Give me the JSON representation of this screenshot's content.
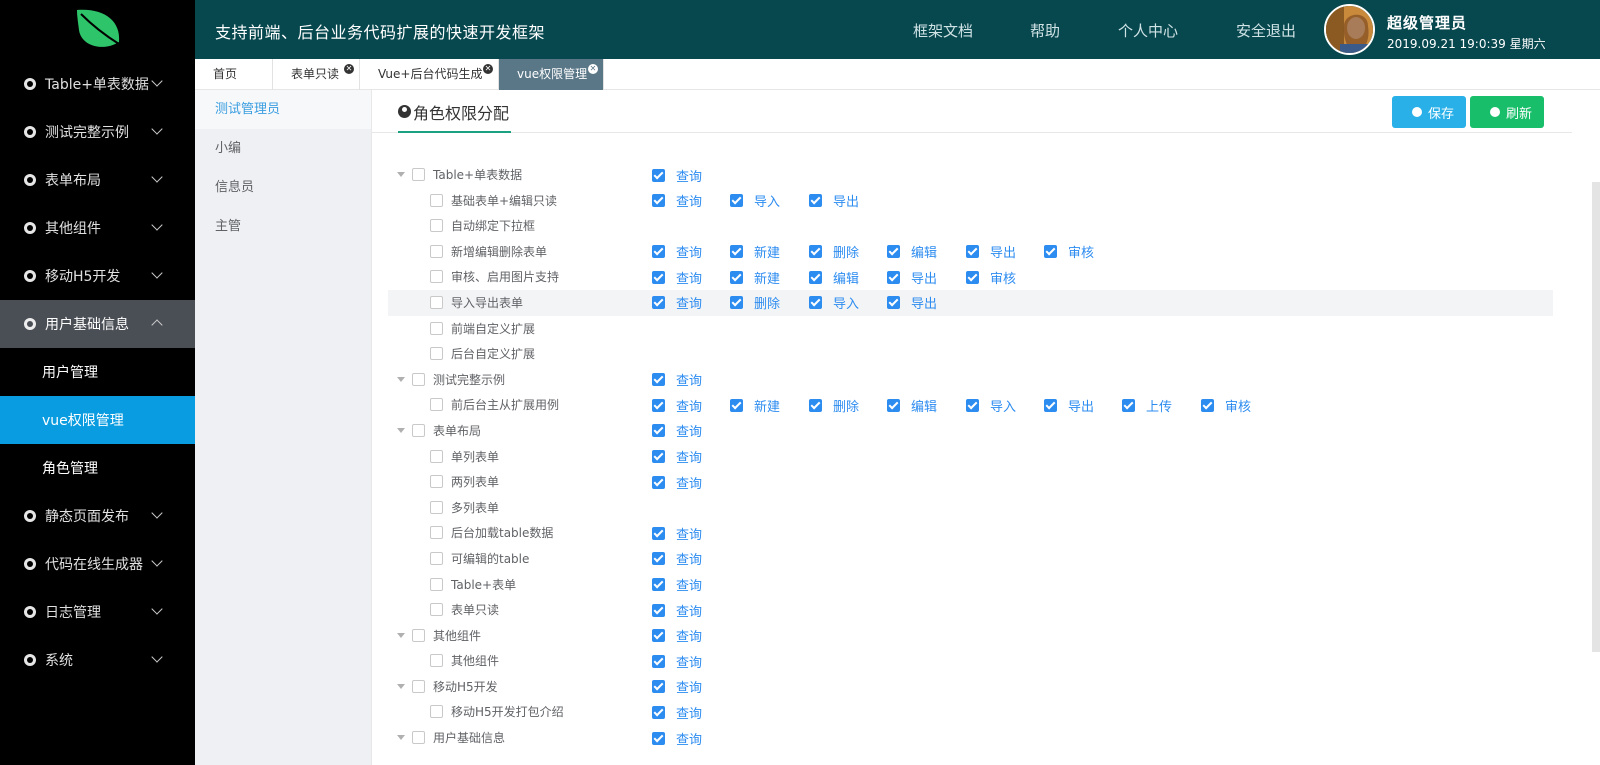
{
  "header": {
    "title": "支持前端、后台业务代码扩展的快速开发框架",
    "nav": [
      "框架文档",
      "帮助",
      "个人中心",
      "安全退出"
    ],
    "user_name": "超级管理员",
    "user_time": "2019.09.21 19:0:39 星期六"
  },
  "sidebar": {
    "items": [
      {
        "label": "Table+单表数据"
      },
      {
        "label": "测试完整示例"
      },
      {
        "label": "表单布局"
      },
      {
        "label": "其他组件"
      },
      {
        "label": "移动H5开发"
      },
      {
        "label": "用户基础信息"
      },
      {
        "label": "静态页面发布"
      },
      {
        "label": "代码在线生成器"
      },
      {
        "label": "日志管理"
      },
      {
        "label": "系统"
      }
    ],
    "open_index": 5,
    "sub_items": [
      "用户管理",
      "vue权限管理",
      "角色管理"
    ],
    "active_sub": 1
  },
  "tabs": [
    {
      "label": "首页",
      "closable": false
    },
    {
      "label": "表单只读",
      "closable": true
    },
    {
      "label": "Vue+后台代码生成",
      "closable": true
    },
    {
      "label": "vue权限管理",
      "closable": true
    }
  ],
  "roles": [
    "测试管理员",
    "小编",
    "信息员",
    "主管"
  ],
  "panel": {
    "title": "角色权限分配",
    "save_label": "保存",
    "refresh_label": "刷新"
  },
  "tree": [
    {
      "level": 0,
      "label": "Table+单表数据",
      "perms": [
        "查询"
      ]
    },
    {
      "level": 1,
      "label": "基础表单+编辑只读",
      "perms": [
        "查询",
        "导入",
        "导出"
      ]
    },
    {
      "level": 1,
      "label": "自动绑定下拉框",
      "perms": []
    },
    {
      "level": 1,
      "label": "新增编辑删除表单",
      "perms": [
        "查询",
        "新建",
        "删除",
        "编辑",
        "导出",
        "审核"
      ]
    },
    {
      "level": 1,
      "label": "审核、启用图片支持",
      "perms": [
        "查询",
        "新建",
        "编辑",
        "导出",
        "审核"
      ]
    },
    {
      "level": 1,
      "label": "导入导出表单",
      "perms": [
        "查询",
        "删除",
        "导入",
        "导出"
      ],
      "highlight": true
    },
    {
      "level": 1,
      "label": "前端自定义扩展",
      "perms": []
    },
    {
      "level": 1,
      "label": "后台自定义扩展",
      "perms": []
    },
    {
      "level": 0,
      "label": "测试完整示例",
      "perms": [
        "查询"
      ]
    },
    {
      "level": 1,
      "label": "前后台主从扩展用例",
      "perms": [
        "查询",
        "新建",
        "删除",
        "编辑",
        "导入",
        "导出",
        "上传",
        "审核"
      ]
    },
    {
      "level": 0,
      "label": "表单布局",
      "perms": [
        "查询"
      ]
    },
    {
      "level": 1,
      "label": "单列表单",
      "perms": [
        "查询"
      ]
    },
    {
      "level": 1,
      "label": "两列表单",
      "perms": [
        "查询"
      ]
    },
    {
      "level": 1,
      "label": "多列表单",
      "perms": []
    },
    {
      "level": 1,
      "label": "后台加载table数据",
      "perms": [
        "查询"
      ]
    },
    {
      "level": 1,
      "label": "可编辑的table",
      "perms": [
        "查询"
      ]
    },
    {
      "level": 1,
      "label": "Table+表单",
      "perms": [
        "查询"
      ]
    },
    {
      "level": 1,
      "label": "表单只读",
      "perms": [
        "查询"
      ]
    },
    {
      "level": 0,
      "label": "其他组件",
      "perms": [
        "查询"
      ]
    },
    {
      "level": 1,
      "label": "其他组件",
      "perms": [
        "查询"
      ]
    },
    {
      "level": 0,
      "label": "移动H5开发",
      "perms": [
        "查询"
      ]
    },
    {
      "level": 1,
      "label": "移动H5开发打包介绍",
      "perms": [
        "查询"
      ]
    },
    {
      "level": 0,
      "label": "用户基础信息",
      "perms": [
        "查询"
      ]
    }
  ],
  "colors": {
    "header_bg": "#07474e",
    "sidebar_bg": "#000000",
    "active_blue": "#0a9ce0",
    "check_blue": "#2d8cf0",
    "save_btn": "#29b0e8",
    "refresh_btn": "#19be6b",
    "logo_green": "#2ec46a"
  }
}
